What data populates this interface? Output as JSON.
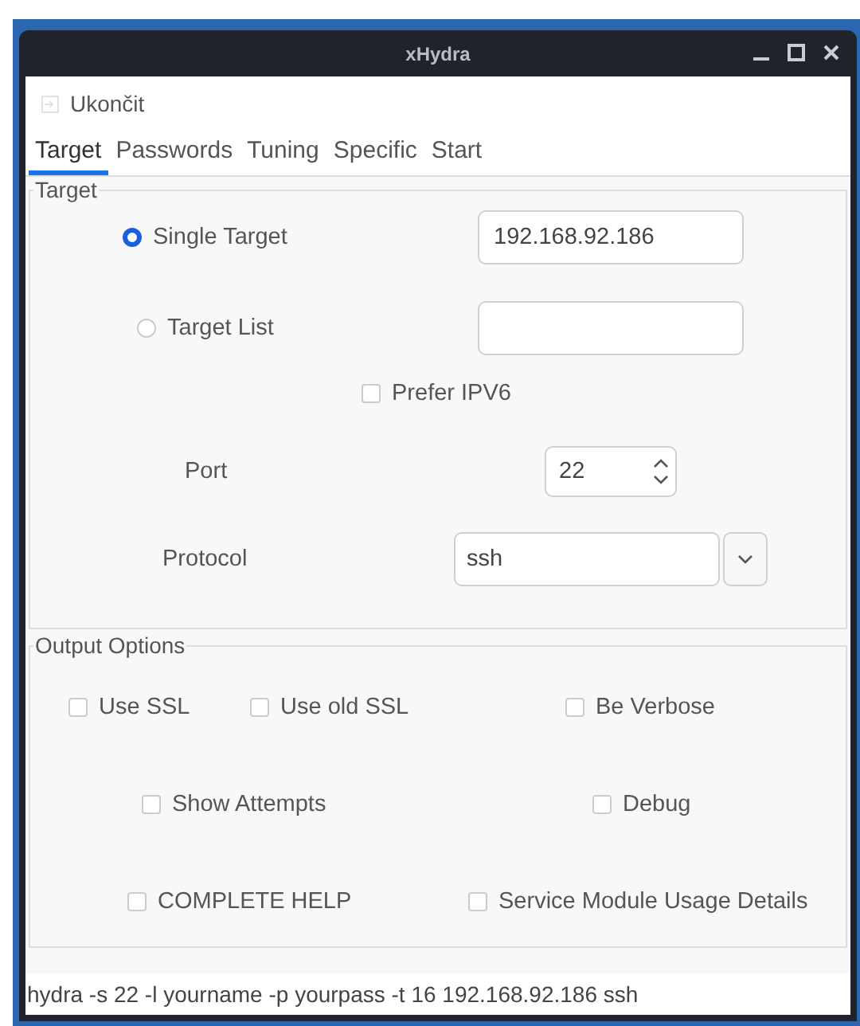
{
  "window": {
    "title": "xHydra"
  },
  "menu": {
    "items": [
      {
        "label": "Ukončit"
      }
    ]
  },
  "tabs": [
    {
      "label": "Target",
      "selected": true
    },
    {
      "label": "Passwords",
      "selected": false
    },
    {
      "label": "Tuning",
      "selected": false
    },
    {
      "label": "Specific",
      "selected": false
    },
    {
      "label": "Start",
      "selected": false
    }
  ],
  "target": {
    "title": "Target",
    "modes": [
      {
        "label": "Single Target",
        "selected": true,
        "value": "192.168.92.186"
      },
      {
        "label": "Target List",
        "selected": false
      }
    ],
    "prefer_ipv6": {
      "label": "Prefer IPV6",
      "checked": false
    },
    "port": {
      "label": "Port",
      "value": "22"
    },
    "protocol": {
      "label": "Protocol",
      "value": "ssh"
    }
  },
  "output_options": {
    "title": "Output Options",
    "rows": [
      [
        {
          "label": "Use SSL",
          "checked": false
        },
        {
          "label": "Use old SSL",
          "checked": false
        },
        {
          "label": "Be Verbose",
          "checked": false
        }
      ],
      [
        {
          "label": "Show Attempts",
          "checked": false
        },
        {
          "label": "Debug",
          "checked": false
        }
      ],
      [
        {
          "label": "COMPLETE HELP",
          "checked": false
        },
        {
          "label": "Service Module Usage Details",
          "checked": false
        }
      ]
    ]
  },
  "status_bar": {
    "text": "hydra -s 22 -l yourname -p yourpass -t 16 192.168.92.186 ssh"
  }
}
